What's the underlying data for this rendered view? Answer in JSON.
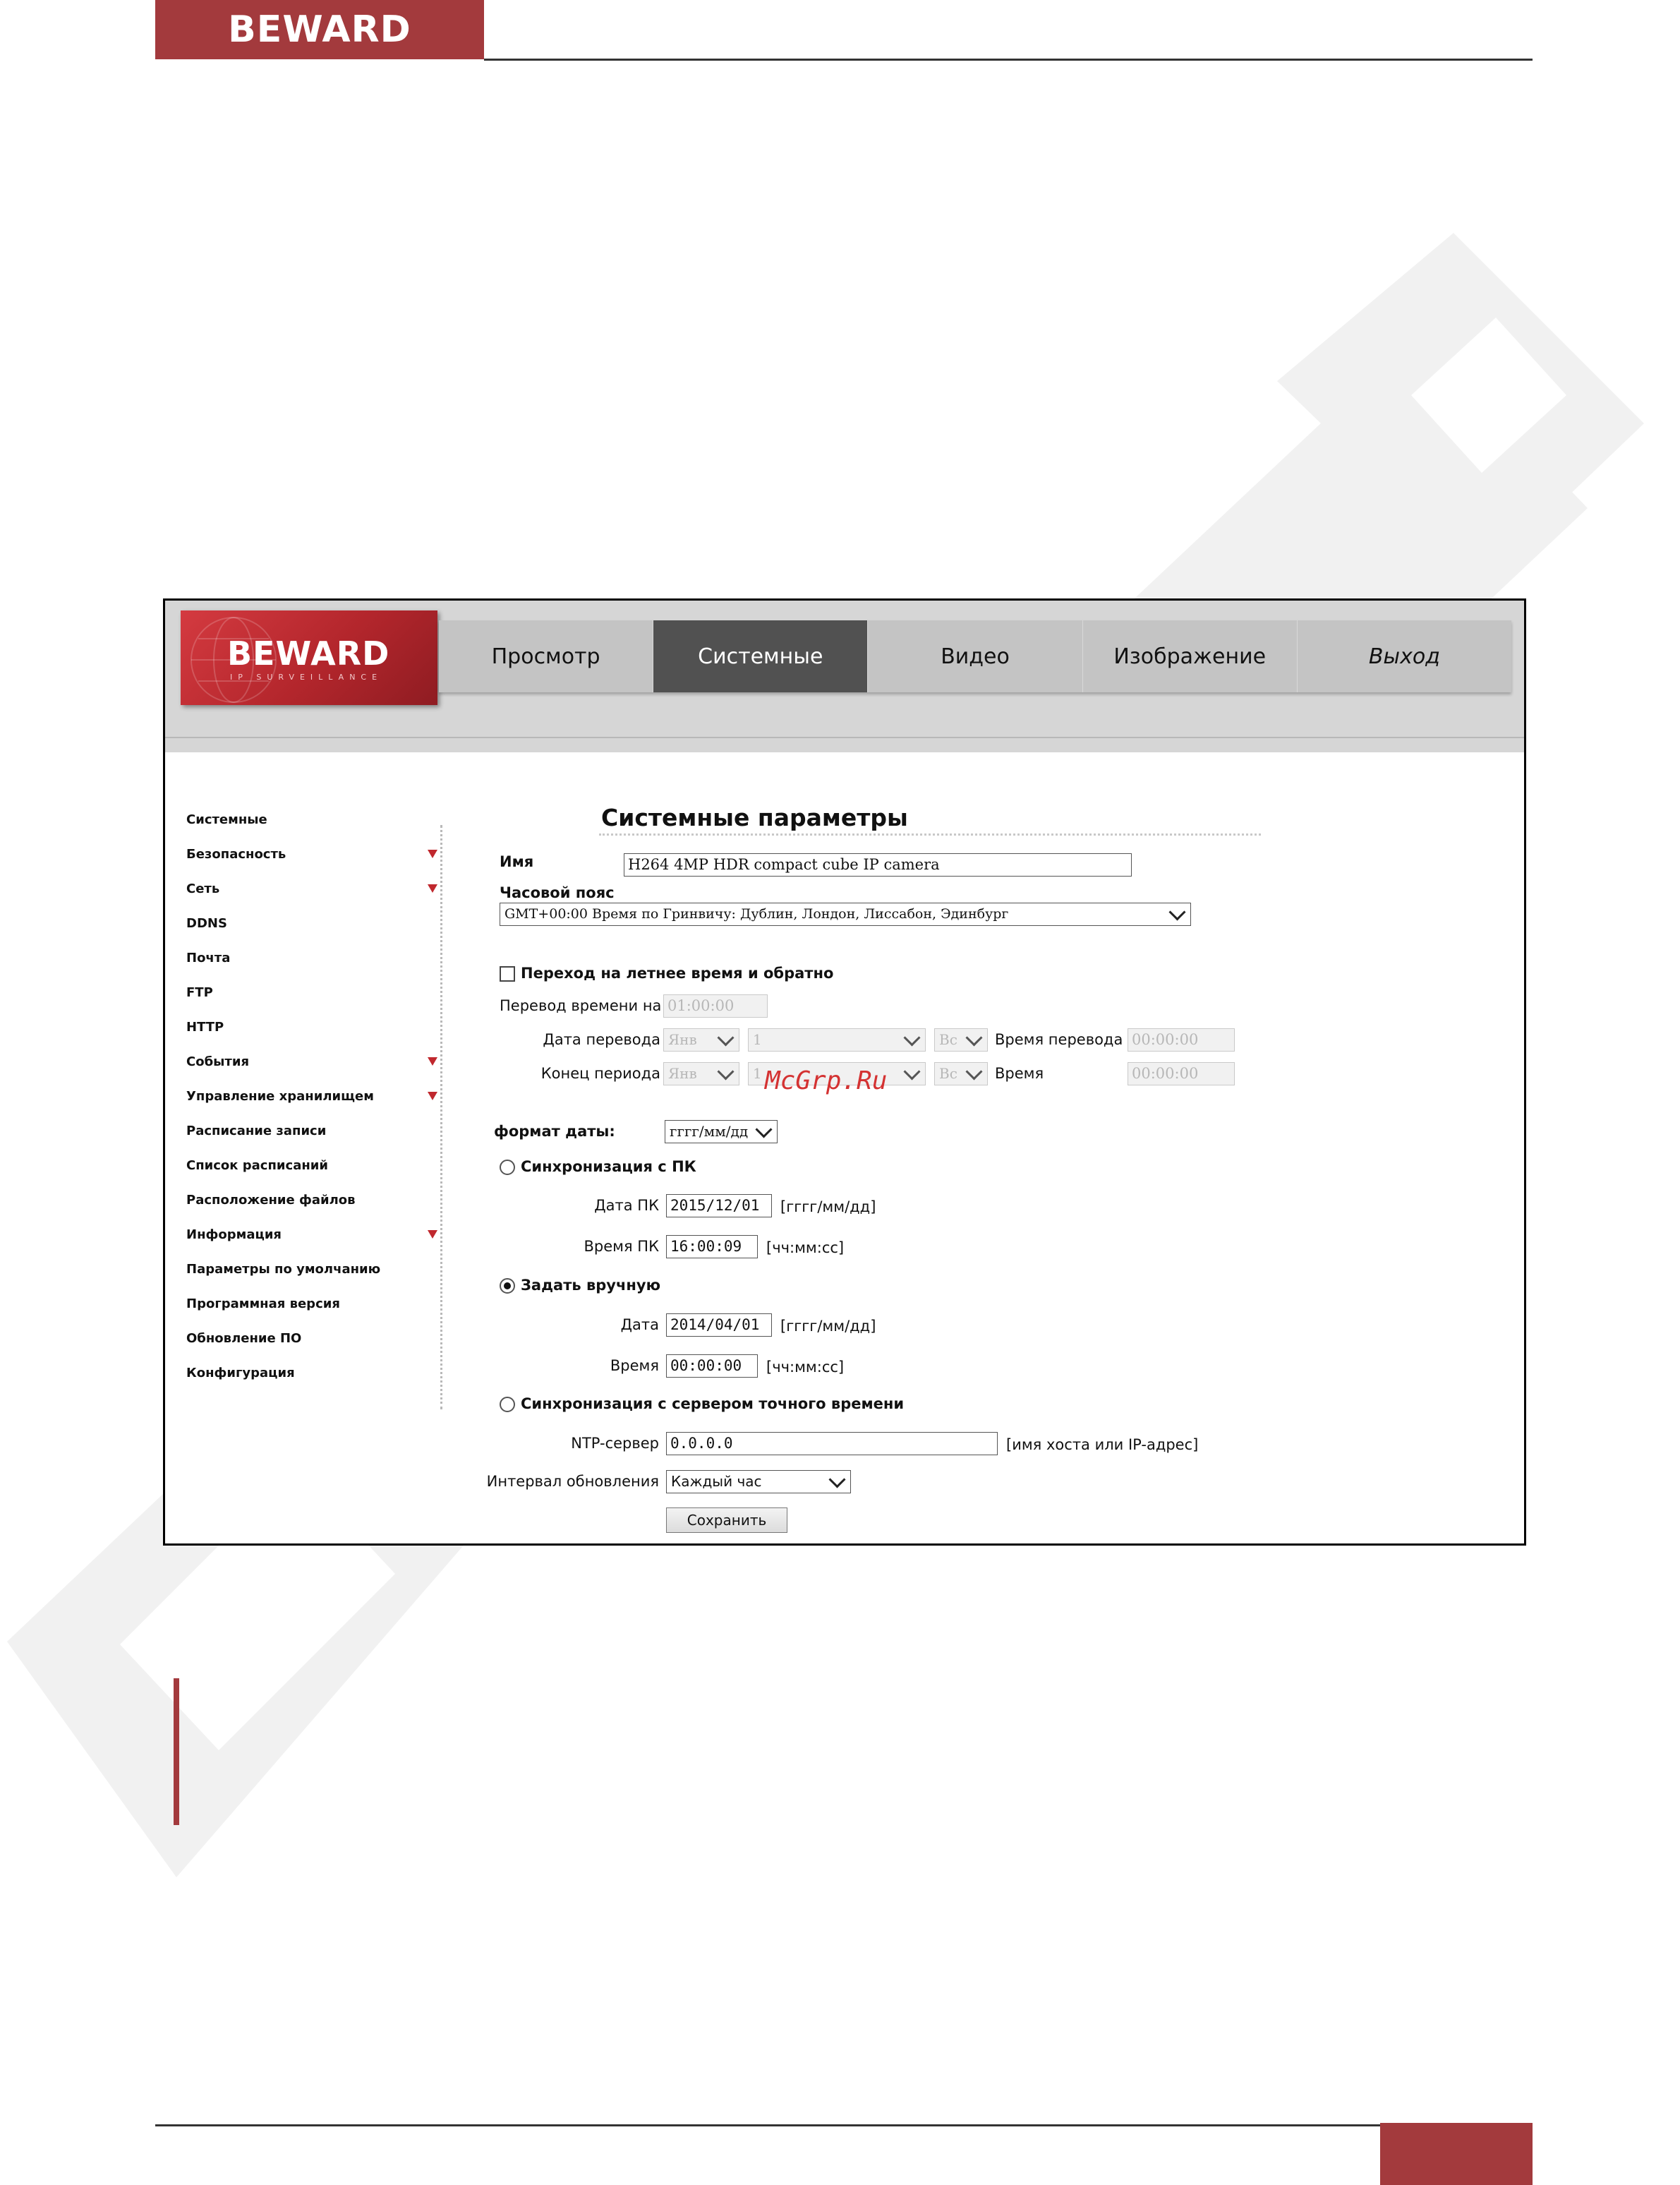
{
  "page": {
    "logo_text": "BEWARD"
  },
  "camera_ui": {
    "logo": {
      "brand": "BEWARD",
      "subtitle": "IP SURVEILLANCE"
    },
    "nav": [
      "Просмотр",
      "Системные",
      "Видео",
      "Изображение",
      "Выход"
    ],
    "nav_active": "Системные",
    "sidebar": [
      {
        "label": "Системные",
        "expandable": false
      },
      {
        "label": "Безопасность",
        "expandable": true
      },
      {
        "label": "Сеть",
        "expandable": true
      },
      {
        "label": "DDNS",
        "expandable": false
      },
      {
        "label": "Почта",
        "expandable": false
      },
      {
        "label": "FTP",
        "expandable": false
      },
      {
        "label": "HTTP",
        "expandable": false
      },
      {
        "label": "События",
        "expandable": true
      },
      {
        "label": "Управление хранилищем",
        "expandable": true
      },
      {
        "label": "Расписание записи",
        "expandable": false
      },
      {
        "label": "Список расписаний",
        "expandable": false
      },
      {
        "label": "Расположение файлов",
        "expandable": false
      },
      {
        "label": "Информация",
        "expandable": true
      },
      {
        "label": "Параметры по умолчанию",
        "expandable": false
      },
      {
        "label": "Программная версия",
        "expandable": false
      },
      {
        "label": "Обновление ПО",
        "expandable": false
      },
      {
        "label": "Конфигурация",
        "expandable": false
      }
    ],
    "form": {
      "title": "Системные параметры",
      "name_label": "Имя",
      "name_value": "H264 4MP HDR compact cube IP camera",
      "timezone_label": "Часовой пояс",
      "timezone_value": "GMT+00:00 Время по Гринвичу: Дублин, Лондон, Лиссабон, Эдинбург",
      "dst": {
        "checkbox_label": "Переход на летнее время и обратно",
        "checked": false,
        "shift_label": "Перевод времени на",
        "shift_value": "01:00:00",
        "start_label": "Дата перевода",
        "start_month": "Янв",
        "start_day": "1",
        "start_weekday": "Вс",
        "start_time_label": "Время перевода",
        "start_time": "00:00:00",
        "end_label": "Конец периода",
        "end_month": "Янв",
        "end_day": "1",
        "end_weekday": "Вс",
        "end_time_label": "Время",
        "end_time": "00:00:00"
      },
      "date_format_label": "формат даты:",
      "date_format_value": "гггг/мм/дд",
      "sync_pc": {
        "label": "Синхронизация с ПК",
        "selected": false,
        "date_label": "Дата ПК",
        "date_value": "2015/12/01",
        "date_hint": "[гггг/мм/дд]",
        "time_label": "Время ПК",
        "time_value": "16:00:09",
        "time_hint": "[чч:мм:сс]"
      },
      "manual": {
        "label": "Задать вручную",
        "selected": true,
        "date_label": "Дата",
        "date_value": "2014/04/01",
        "date_hint": "[гггг/мм/дд]",
        "time_label": "Время",
        "time_value": "00:00:00",
        "time_hint": "[чч:мм:сс]"
      },
      "ntp": {
        "label": "Синхронизация с сервером точного времени",
        "selected": false,
        "server_label": "NTP-сервер",
        "server_value": "0.0.0.0",
        "server_hint": "[имя хоста или IP-адрес]",
        "interval_label": "Интервал обновления",
        "interval_value": "Каждый час"
      },
      "save_label": "Сохранить"
    }
  },
  "watermark_overlay": "McGrp.Ru",
  "colors": {
    "brand": "#a33a3d",
    "nav_active": "#515151",
    "nav_bg": "#c4c4c4",
    "sidebar_arrow": "#c0282e",
    "watermark": "#f2f2f2"
  }
}
